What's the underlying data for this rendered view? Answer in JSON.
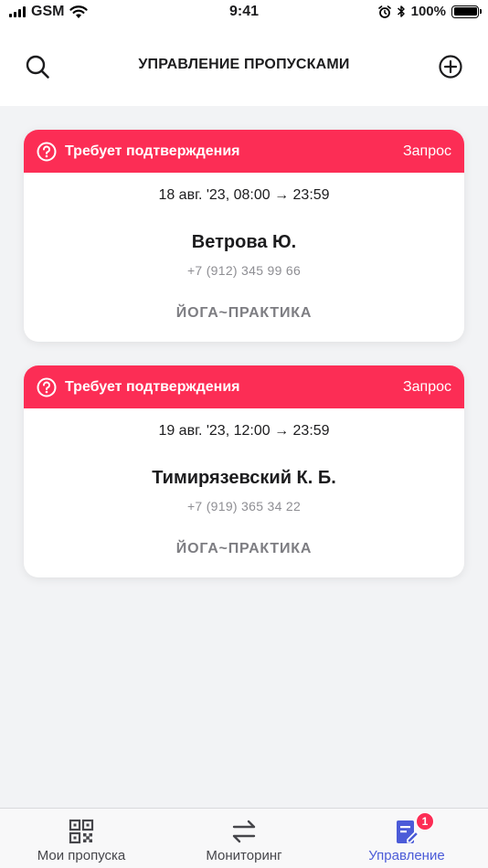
{
  "status_bar": {
    "carrier": "GSM",
    "time": "9:41",
    "battery": "100%"
  },
  "header": {
    "title": "УПРАВЛЕНИЕ ПРОПУСКАМИ",
    "left_icon": "search-icon",
    "right_icon": "plus-circle-icon"
  },
  "passes": [
    {
      "status": "Требует подтверждения",
      "type": "Запрос",
      "date": "18 авг. '23, 08:00 → 23:59",
      "name": "Ветрова Ю.",
      "phone": "+7 (912) 345 99 66",
      "place": "ЙОГА~ПРАКТИКА"
    },
    {
      "status": "Требует подтверждения",
      "type": "Запрос",
      "date": "19 авг. '23, 12:00 → 23:59",
      "name": "Тимирязевский К. Б.",
      "phone": "+7 (919) 365 34 22",
      "place": "ЙОГА~ПРАКТИКА"
    }
  ],
  "tabs": [
    {
      "label": "Мои пропуска",
      "icon": "qr-code-icon",
      "active": false
    },
    {
      "label": "Мониторинг",
      "icon": "arrows-swap-icon",
      "active": false
    },
    {
      "label": "Управление",
      "icon": "manage-document-icon",
      "active": true,
      "badge": "1"
    }
  ],
  "colors": {
    "accent": "#fc2d55",
    "active_tab": "#4b5bd8",
    "background": "#f2f3f5"
  }
}
